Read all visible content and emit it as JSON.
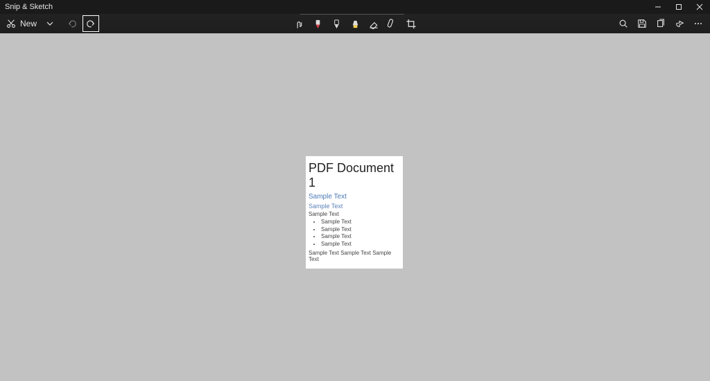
{
  "app": {
    "title": "Snip & Sketch"
  },
  "toolbar": {
    "new_label": "New",
    "icons": {
      "snip": "snip-icon",
      "chevron_down": "chevron-down-icon",
      "undo": "undo-icon",
      "redo": "redo-icon",
      "touch_writing": "touch-writing-icon",
      "ballpoint": "ballpoint-pen-icon",
      "pencil": "pencil-icon",
      "highlighter": "highlighter-icon",
      "eraser": "eraser-icon",
      "ruler": "ruler-icon",
      "crop": "crop-icon",
      "zoom": "zoom-icon",
      "save": "save-icon",
      "copy": "copy-icon",
      "share": "share-icon",
      "more": "more-icon"
    },
    "pen_colors": {
      "ballpoint": "#d24045",
      "pencil": "#dcdcdc",
      "highlighter": "#ffd24a"
    }
  },
  "window_controls": {
    "minimize": "minimize-icon",
    "maximize": "maximize-icon",
    "close": "close-icon"
  },
  "snip": {
    "title": "PDF Document 1",
    "heading1": "Sample Text",
    "heading2": "Sample Text",
    "heading3": "Sample Text",
    "bullets": [
      "Sample Text",
      "Sample Text",
      "Sample Text",
      "Sample Text"
    ],
    "footer": "Sample Text Sample Text Sample Text"
  }
}
